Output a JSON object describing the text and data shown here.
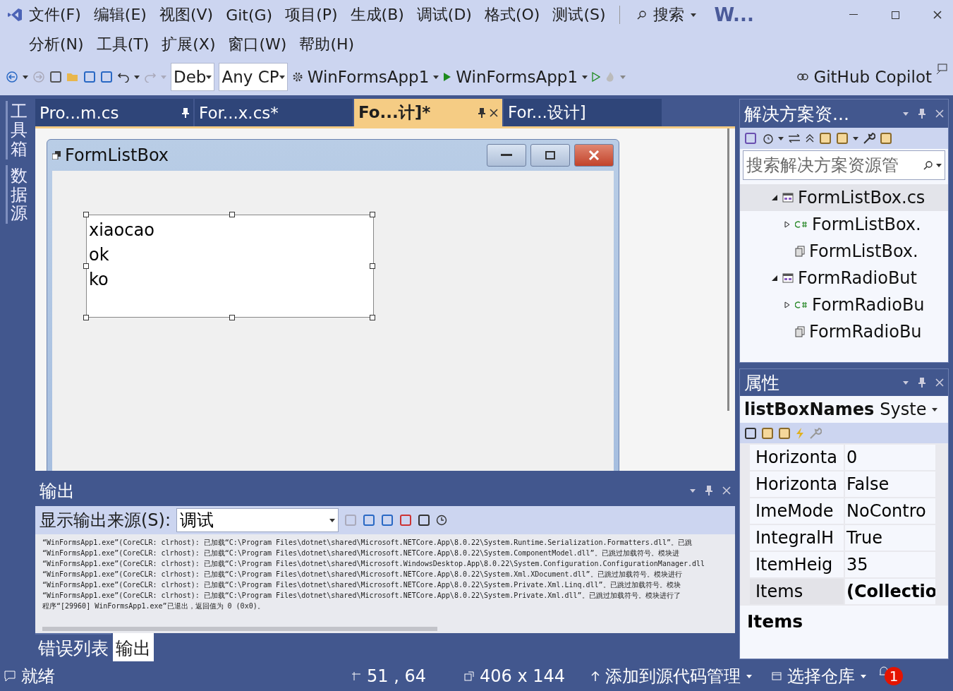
{
  "menu_rows": [
    [
      "文件(F)",
      "编辑(E)",
      "视图(V)",
      "Git(G)",
      "项目(P)",
      "生成(B)",
      "调试(D)",
      "格式(O)",
      "测试(S)"
    ],
    [
      "分析(N)",
      "工具(T)",
      "扩展(X)",
      "窗口(W)",
      "帮助(H)"
    ]
  ],
  "search": "搜索",
  "window_title": "W...",
  "toolbar": {
    "configuration": "Deb",
    "platform": "Any CP",
    "project": "WinFormsApp1",
    "start": "WinFormsApp1",
    "copilot": "GitHub Copilot"
  },
  "side_tabs": [
    "工具箱",
    "数据源"
  ],
  "doc_tabs": [
    {
      "label": "Pro...m.cs",
      "selected": false,
      "pinned": true
    },
    {
      "label": "For...x.cs*",
      "selected": false,
      "pinned": false
    },
    {
      "label": "Fo...计]*",
      "selected": true,
      "pinned": true
    },
    {
      "label": "For...设计]",
      "selected": false,
      "pinned": false
    }
  ],
  "form": {
    "title": "FormListBox",
    "listbox_items": [
      "xiaocao",
      "ok",
      "ko"
    ]
  },
  "output": {
    "title": "输出",
    "source_label": "显示输出来源(S):",
    "source": "调试",
    "lines": [
      "“WinFormsApp1.exe”(CoreCLR: clrhost): 已加载“C:\\Program Files\\dotnet\\shared\\Microsoft.NETCore.App\\8.0.22\\System.Runtime.Serialization.Formatters.dll”。已跳",
      "“WinFormsApp1.exe”(CoreCLR: clrhost): 已加载“C:\\Program Files\\dotnet\\shared\\Microsoft.NETCore.App\\8.0.22\\System.ComponentModel.dll”。已跳过加载符号。模块进",
      "“WinFormsApp1.exe”(CoreCLR: clrhost): 已加载“C:\\Program Files\\dotnet\\shared\\Microsoft.WindowsDesktop.App\\8.0.22\\System.Configuration.ConfigurationManager.dll",
      "“WinFormsApp1.exe”(CoreCLR: clrhost): 已加载“C:\\Program Files\\dotnet\\shared\\Microsoft.NETCore.App\\8.0.22\\System.Xml.XDocument.dll”。已跳过加载符号。模块进行",
      "“WinFormsApp1.exe”(CoreCLR: clrhost): 已加载“C:\\Program Files\\dotnet\\shared\\Microsoft.NETCore.App\\8.0.22\\System.Private.Xml.Linq.dll”。已跳过加载符号。模块",
      "“WinFormsApp1.exe”(CoreCLR: clrhost): 已加载“C:\\Program Files\\dotnet\\shared\\Microsoft.NETCore.App\\8.0.22\\System.Private.Xml.dll”。已跳过加载符号。模块进行了",
      "程序“[29960] WinFormsApp1.exe”已退出，返回值为 0 (0x0)。"
    ]
  },
  "bottom_tabs": [
    {
      "label": "错误列表",
      "selected": false
    },
    {
      "label": "输出",
      "selected": true
    }
  ],
  "solution_explorer": {
    "title": "解决方案资...",
    "search_placeholder": "搜索解决方案资源管",
    "tree": [
      {
        "label": "FormListBox.cs",
        "kind": "form",
        "expanded": true,
        "selected": true,
        "children": [
          {
            "label": "FormListBox.",
            "kind": "cs",
            "expanded": false,
            "selected": false
          },
          {
            "label": "FormListBox.",
            "kind": "resx",
            "selected": false
          }
        ]
      },
      {
        "label": "FormRadioBut",
        "kind": "form",
        "expanded": true,
        "selected": false,
        "children": [
          {
            "label": "FormRadioBu",
            "kind": "cs",
            "expanded": false,
            "selected": false
          },
          {
            "label": "FormRadioBu",
            "kind": "resx",
            "selected": false
          }
        ]
      }
    ]
  },
  "properties": {
    "title": "属性",
    "object_name": "listBoxNames",
    "object_type": "Syste",
    "rows": [
      {
        "name": "Horizonta",
        "value": "0",
        "selected": false,
        "modified": false
      },
      {
        "name": "Horizonta",
        "value": "False",
        "selected": false,
        "modified": false
      },
      {
        "name": "ImeMode",
        "value": "NoContro",
        "selected": false,
        "modified": false
      },
      {
        "name": "IntegralH",
        "value": "True",
        "selected": false,
        "modified": false
      },
      {
        "name": "ItemHeig",
        "value": "35",
        "selected": false,
        "modified": false
      },
      {
        "name": "Items",
        "value": "(Collectio",
        "selected": true,
        "modified": true
      }
    ],
    "description_title": "Items"
  },
  "status": {
    "message": "就绪",
    "position": "51 , 64",
    "size": "406 x 144",
    "source_control": "添加到源代码管理",
    "repository": "选择仓库",
    "notifications": "1"
  }
}
